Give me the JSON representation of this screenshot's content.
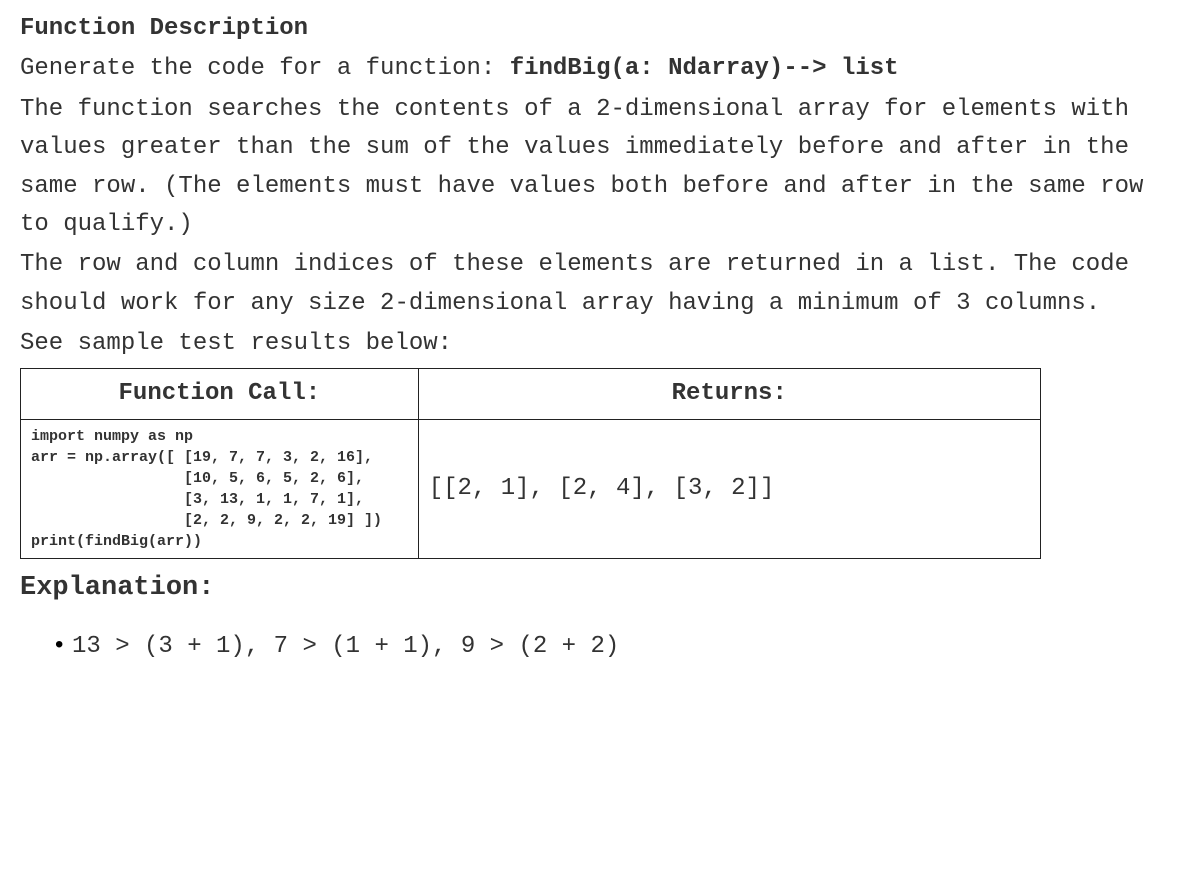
{
  "heading": "Function Description",
  "intro_prefix": "Generate the code for a function: ",
  "signature": "findBig(a: Ndarray)--> list",
  "body": "The function searches the contents of a 2-dimensional array for elements with values greater than the sum of the values immediately before and after in the same row. (The elements must have values both before and after in the same row to qualify.)",
  "body2": "The row and column indices of these elements are returned in a list. The code should work for any size 2-dimensional array having a minimum of 3 columns.",
  "body3": "See sample test results below:",
  "table": {
    "header_left": "Function Call:",
    "header_right": "Returns:",
    "code": "import numpy as np\narr = np.array([ [19, 7, 7, 3, 2, 16],\n                 [10, 5, 6, 5, 2, 6],\n                 [3, 13, 1, 1, 7, 1],\n                 [2, 2, 9, 2, 2, 19] ])\nprint(findBig(arr))",
    "returns": "[[2, 1], [2, 4], [3, 2]]"
  },
  "explanation_heading": "Explanation:",
  "explanation_item": "13 > (3 + 1), 7 > (1 + 1), 9 > (2 + 2)"
}
